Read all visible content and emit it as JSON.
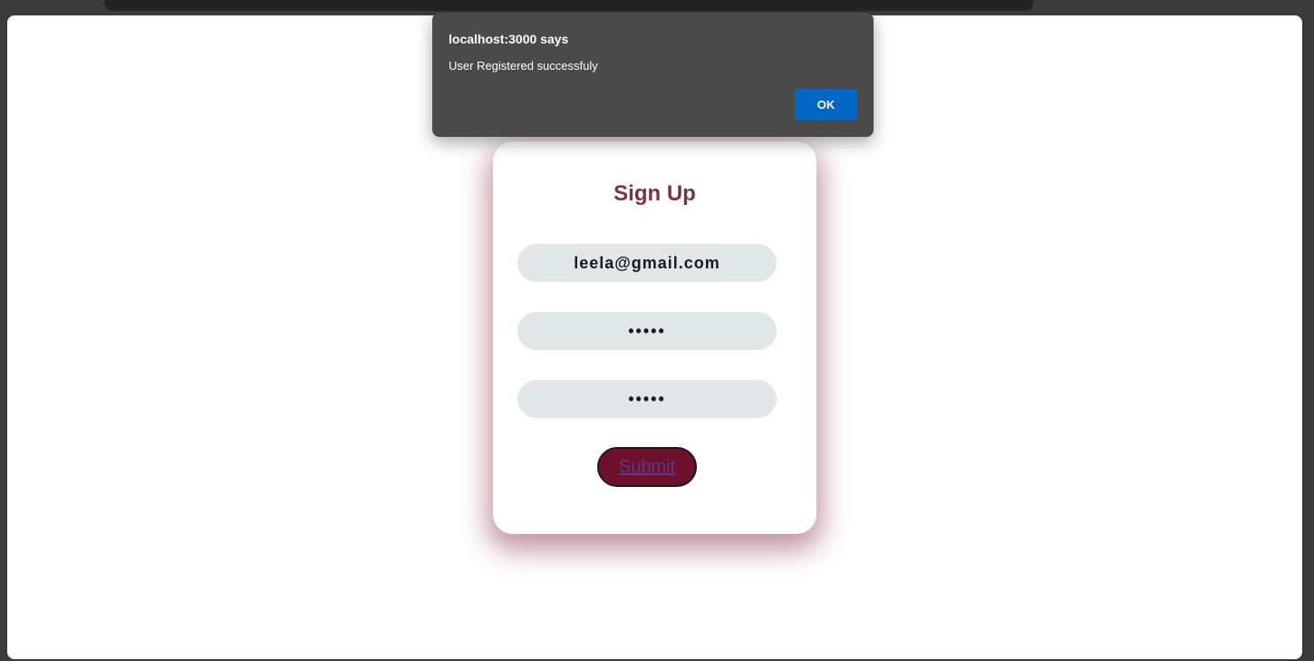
{
  "alert": {
    "title": "localhost:3000 says",
    "message": "User Registered successfuly",
    "ok_label": "OK",
    "ok_color": "#0068c2"
  },
  "signup": {
    "title": "Sign Up",
    "email_value": "leela@gmail.com",
    "password_value": "12345",
    "confirm_password_value": "12345",
    "submit_label": "Submit",
    "title_color": "#7a3145",
    "submit_color": "#6e0f2c"
  }
}
